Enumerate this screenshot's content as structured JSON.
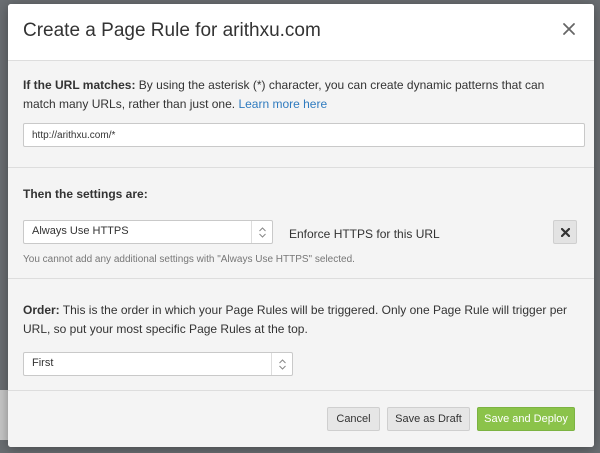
{
  "modal": {
    "title": "Create a Page Rule for arithxu.com"
  },
  "url_section": {
    "label": "If the URL matches:",
    "description": " By using the asterisk (*) character, you can create dynamic patterns that can match many URLs, rather than just one. ",
    "learn_more": "Learn more here",
    "url_value": "http://arithxu.com/*"
  },
  "settings_section": {
    "title": "Then the settings are:",
    "setting_selected": "Always Use HTTPS",
    "setting_description": "Enforce HTTPS for this URL",
    "note": "You cannot add any additional settings with \"Always Use HTTPS\" selected."
  },
  "order_section": {
    "label": "Order:",
    "description": " This is the order in which your Page Rules will be triggered. Only one Page Rule will trigger per URL, so put your most specific Page Rules at the top.",
    "order_selected": "First"
  },
  "footer": {
    "cancel_label": "Cancel",
    "draft_label": "Save as Draft",
    "deploy_label": "Save and Deploy"
  },
  "colors": {
    "deploy_button": "#8bc34a",
    "link": "#2f7bbf",
    "section_background": "#f4f4f4"
  },
  "icons": {
    "close": "close-icon",
    "remove": "remove-setting-icon",
    "select_arrows": "select-arrows-icon"
  }
}
